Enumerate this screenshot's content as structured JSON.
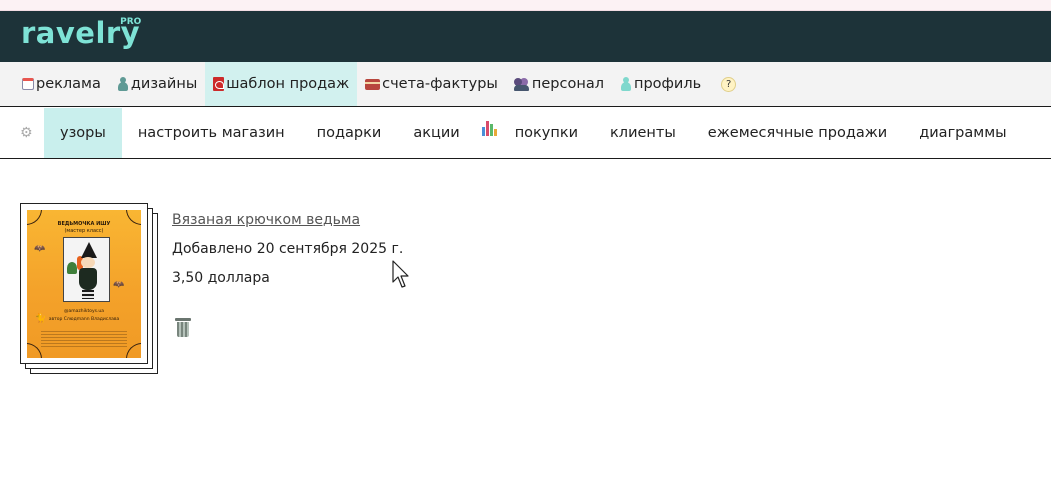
{
  "header": {
    "logo_text": "ravelry",
    "logo_badge": "PRO",
    "brand_color": "#1d3339",
    "accent_color": "#7ee3d6"
  },
  "pro_nav": {
    "items": [
      {
        "label": "реклама",
        "icon": "calendar-icon"
      },
      {
        "label": "дизайны",
        "icon": "designer-icon"
      },
      {
        "label": "шаблон продаж",
        "icon": "pdf-icon",
        "active": true
      },
      {
        "label": "счета-фактуры",
        "icon": "credit-card-icon"
      },
      {
        "label": "персонал",
        "icon": "people-icon"
      },
      {
        "label": "профиль",
        "icon": "profile-icon"
      }
    ],
    "help_label": "?"
  },
  "shop_nav": {
    "items": [
      {
        "label": "узоры",
        "active": true
      },
      {
        "label": "настроить магазин"
      },
      {
        "label": "подарки"
      },
      {
        "label": "акции"
      },
      {
        "label": "покупки"
      },
      {
        "label": "клиенты"
      },
      {
        "label": "ежемесячные продажи"
      },
      {
        "label": "диаграммы"
      }
    ],
    "active_color": "#c9efed"
  },
  "pattern": {
    "title": "Вязаная крючком ведьма",
    "added": "Добавлено 20 сентября 2025 г.",
    "price": "3,50 доллара",
    "cover_title": "ВЕДЬМОЧКА ИШУ",
    "cover_subtitle": "(мастер класс)",
    "cover_handle": "@amazhiktoys.ua",
    "cover_author": "автор Слюдmann Владислава"
  }
}
